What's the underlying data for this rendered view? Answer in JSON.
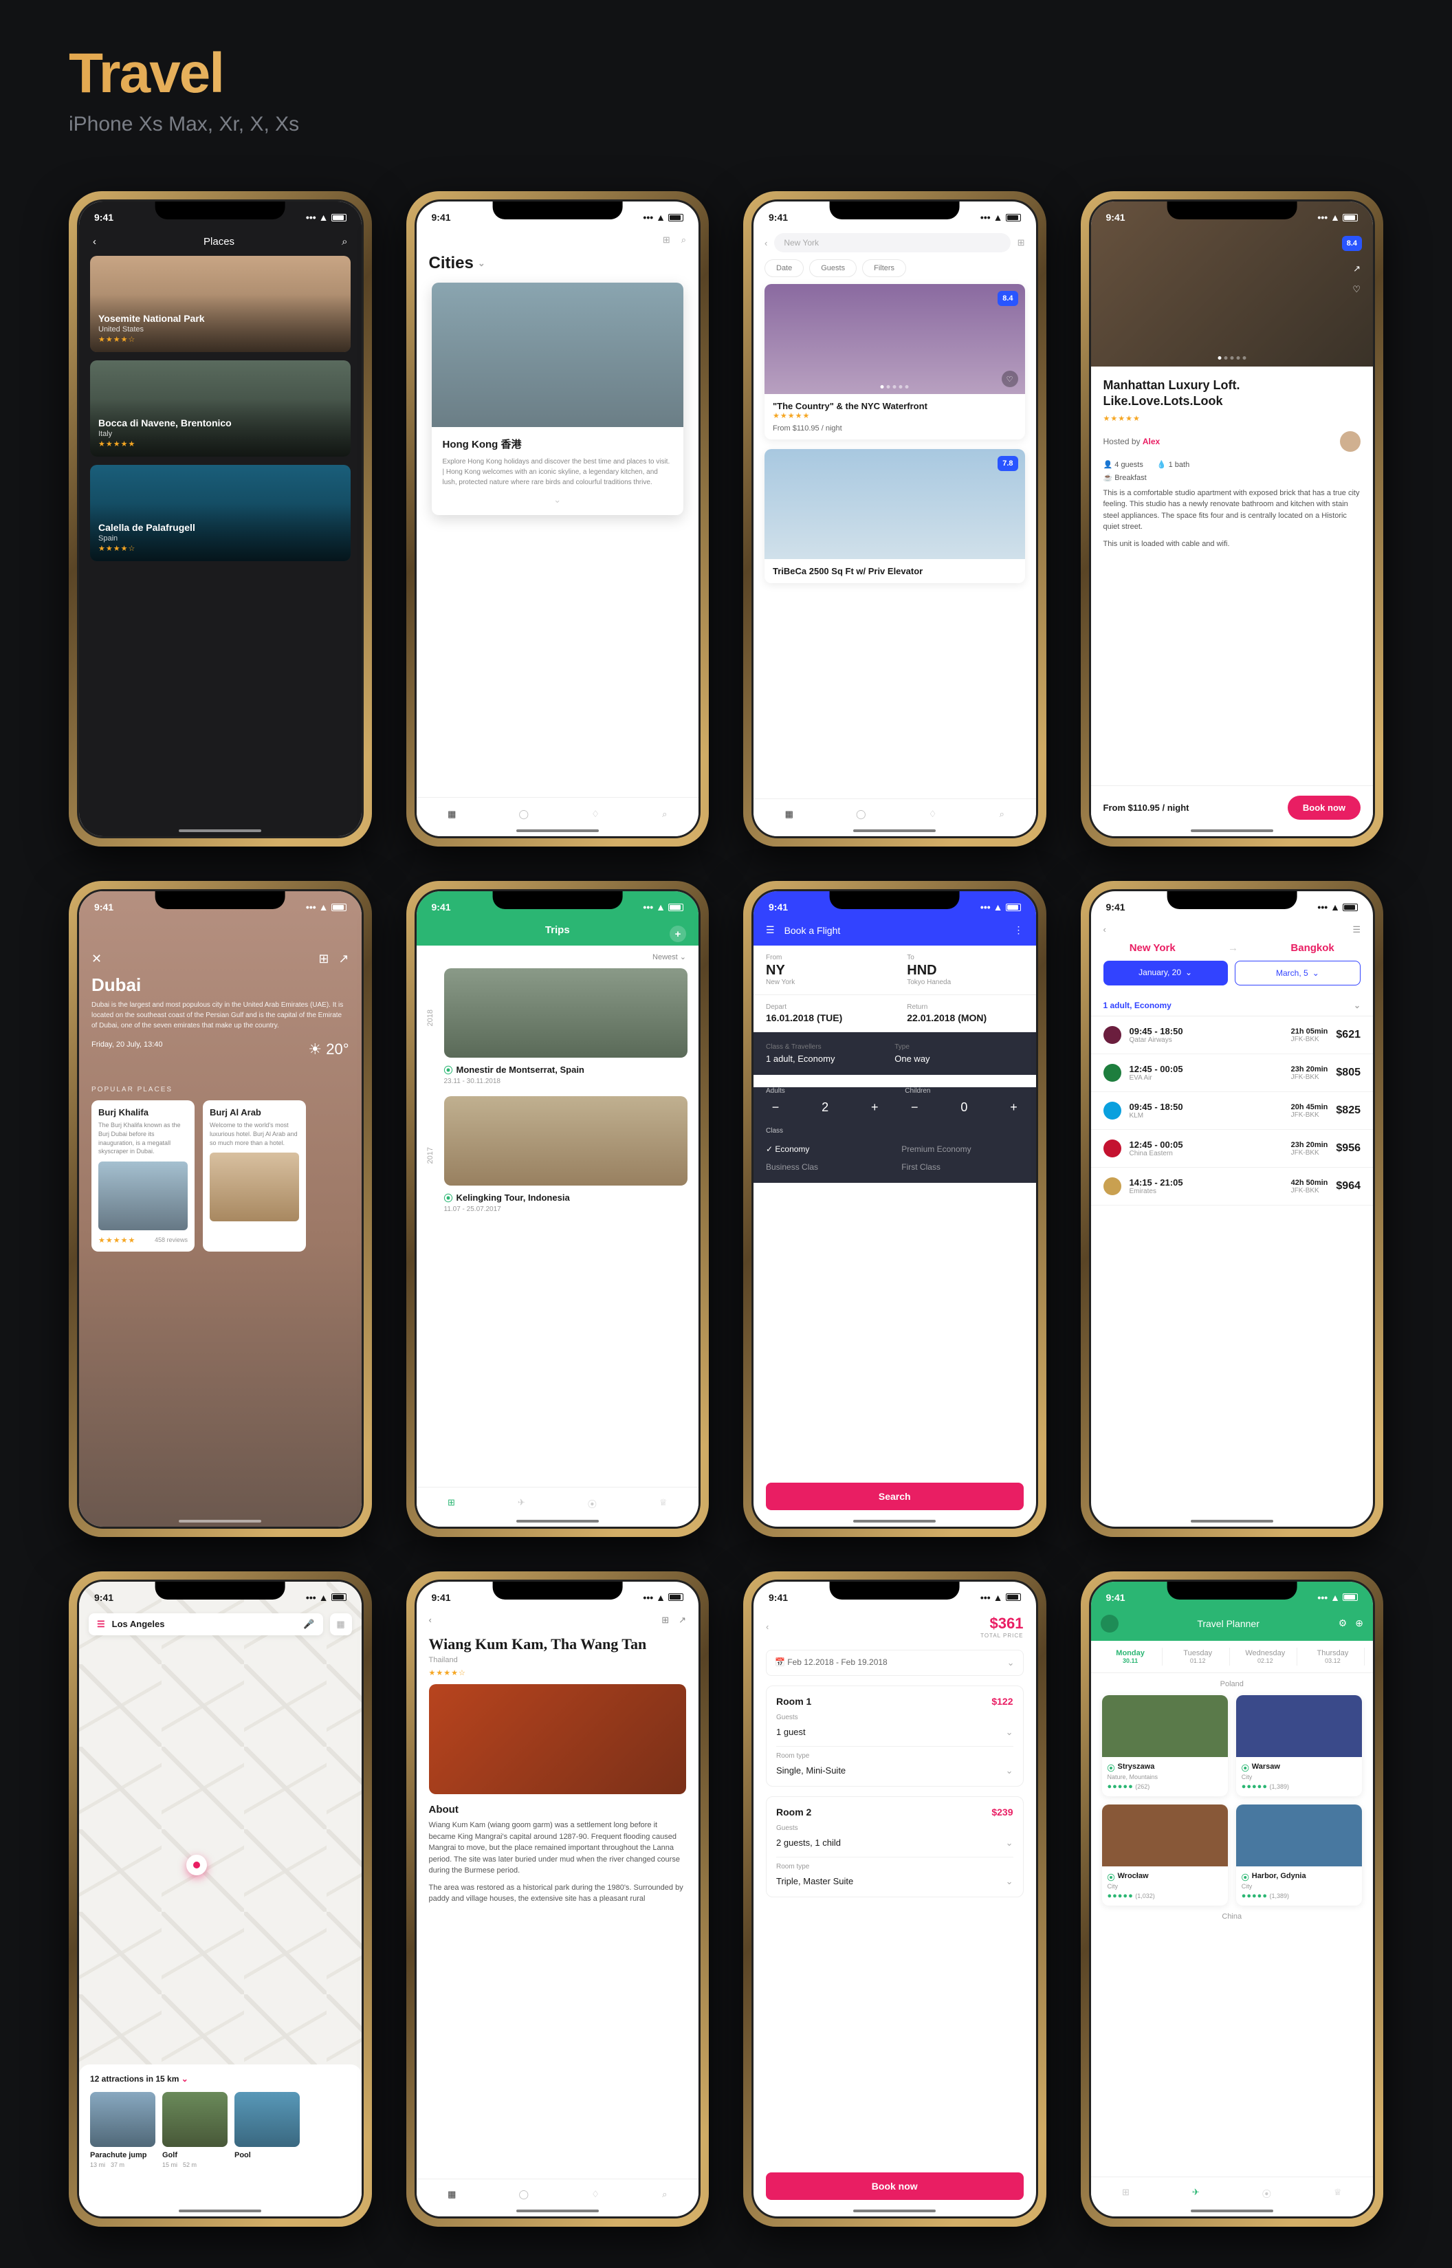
{
  "page": {
    "title": "Travel",
    "subtitle": "iPhone Xs Max, Xr, X, Xs",
    "time": "9:41"
  },
  "p1": {
    "title": "Places",
    "items": [
      {
        "name": "Yosemite National Park",
        "country": "United States"
      },
      {
        "name": "Bocca di Navene, Brentonico",
        "country": "Italy"
      },
      {
        "name": "Calella de Palafrugell",
        "country": "Spain"
      }
    ]
  },
  "p2": {
    "title": "Cities",
    "city": {
      "name": "Hong Kong 香港",
      "desc": "Explore Hong Kong holidays and discover the best time and places to visit. | Hong Kong welcomes with an iconic skyline, a legendary kitchen, and lush, protected nature where rare birds and colourful traditions thrive."
    }
  },
  "p3": {
    "search": "New York",
    "filters": [
      "Date",
      "Guests",
      "Filters"
    ],
    "hotels": [
      {
        "name": "\"The Country\" & the NYC Waterfront",
        "price": "From $110.95 / night",
        "rating": "8.4"
      },
      {
        "name": "TriBeCa 2500 Sq Ft w/ Priv Elevator",
        "rating": "7.8"
      }
    ]
  },
  "p4": {
    "title": "Manhattan Luxury Loft. Like.Love.Lots.Look",
    "rating": "8.4",
    "host_label": "Hosted by",
    "host": "Alex",
    "guests": "4 guests",
    "bath": "1 bath",
    "breakfast": "Breakfast",
    "desc1": "This is a comfortable studio apartment with exposed brick that has a true city feeling. This studio has a newly renovate bathroom and kitchen with stain steel appliances. The space fits four and is centrally located on a Historic quiet street.",
    "desc2": "This unit is loaded with cable and wifi.",
    "price": "From $110.95 / night",
    "book": "Book now"
  },
  "p5": {
    "title": "Dubai",
    "desc": "Dubai is the largest and most populous city in the United Arab Emirates (UAE). It is located on the southeast coast of the Persian Gulf and is the capital of the Emirate of Dubai, one of the seven emirates that make up the country.",
    "date": "Friday, 20 July, 13:40",
    "temp": "20°",
    "label": "POPULAR PLACES",
    "places": [
      {
        "name": "Burj Khalifa",
        "desc": "The Burj Khalifa known as the Burj Dubai before its inauguration, is a megatall skyscraper in Dubai.",
        "reviews": "458 reviews"
      },
      {
        "name": "Burj Al Arab",
        "desc": "Welcome to the world's most luxurious hotel. Burj Al Arab and so much more than a hotel.",
        "reviews": ""
      }
    ]
  },
  "p6": {
    "title": "Trips",
    "sort": "Newest",
    "years": [
      "2018",
      "2017"
    ],
    "trips": [
      {
        "name": "Monestir de Montserrat, Spain",
        "date": "23.11 - 30.11.2018"
      },
      {
        "name": "Kelingking Tour, Indonesia",
        "date": "11.07 - 25.07.2017"
      }
    ]
  },
  "p7": {
    "title": "Book a Flight",
    "from_lbl": "From",
    "from": "NY",
    "from_city": "New York",
    "to_lbl": "To",
    "to": "HND",
    "to_city": "Tokyo Haneda",
    "depart_lbl": "Depart",
    "depart": "16.01.2018 (TUE)",
    "return_lbl": "Return",
    "return": "22.01.2018 (MON)",
    "class_lbl": "Class & Travellers",
    "class_val": "1 adult, Economy",
    "type_lbl": "Type",
    "type_val": "One way",
    "adults_lbl": "Adults",
    "adults": "2",
    "children_lbl": "Children",
    "children": "0",
    "class_head": "Class",
    "classes": [
      "Economy",
      "Premium Economy",
      "Business Clas",
      "First Class"
    ],
    "search": "Search"
  },
  "p8": {
    "from": "New York",
    "to": "Bangkok",
    "date_from": "January, 20",
    "date_to": "March, 5",
    "pax": "1 adult, Economy",
    "flights": [
      {
        "time": "09:45 - 18:50",
        "airline": "Qatar Airways",
        "dur": "21h 05min",
        "route": "JFK-BKK",
        "price": "$621",
        "color": "#6b1e3e"
      },
      {
        "time": "12:45 - 00:05",
        "airline": "EVA Air",
        "dur": "23h 20min",
        "route": "JFK-BKK",
        "price": "$805",
        "color": "#1e7e3e"
      },
      {
        "time": "09:45 - 18:50",
        "airline": "KLM",
        "dur": "20h 45min",
        "route": "JFK-BKK",
        "price": "$825",
        "color": "#0aa0de"
      },
      {
        "time": "12:45 - 00:05",
        "airline": "China Eastern",
        "dur": "23h 20min",
        "route": "JFK-BKK",
        "price": "$956",
        "color": "#c41230"
      },
      {
        "time": "14:15 - 21:05",
        "airline": "Emirates",
        "dur": "42h 50min",
        "route": "JFK-BKK",
        "price": "$964",
        "color": "#c9a050"
      }
    ]
  },
  "p9": {
    "location": "Los Angeles",
    "summary": "12 attractions in 15 km",
    "acts": [
      {
        "name": "Parachute jump",
        "dist": "13 mi",
        "time": "37 m"
      },
      {
        "name": "Golf",
        "dist": "15 mi",
        "time": "52 m"
      },
      {
        "name": "Pool",
        "dist": "",
        "time": ""
      }
    ]
  },
  "p10": {
    "title": "Wiang Kum Kam, Tha Wang Tan",
    "location": "Thailand",
    "about": "About",
    "p1": "Wiang Kum Kam (wiang goom garm) was a settlement long before it became King Mangrai's capital around 1287-90. Frequent flooding caused Mangrai to move, but the place remained important throughout the Lanna period. The site was later buried under mud when the river changed course during the Burmese period.",
    "p2": "The area was restored as a historical park during the 1980's. Surrounded by paddy and village houses, the extensive site has a pleasant rural"
  },
  "p11": {
    "total": "$361",
    "total_lbl": "TOTAL PRICE",
    "range": "Feb 12.2018 - Feb 19.2018",
    "rooms": [
      {
        "name": "Room 1",
        "price": "$122",
        "guests_lbl": "Guests",
        "guests": "1 guest",
        "type_lbl": "Room type",
        "type": "Single, Mini-Suite"
      },
      {
        "name": "Room 2",
        "price": "$239",
        "guests_lbl": "Guests",
        "guests": "2 guests, 1 child",
        "type_lbl": "Room type",
        "type": "Triple, Master Suite"
      }
    ],
    "book": "Book now"
  },
  "p12": {
    "title": "Travel Planner",
    "days": [
      {
        "name": "Monday",
        "date": "30.11",
        "active": true
      },
      {
        "name": "Tuesday",
        "date": "01.12"
      },
      {
        "name": "Wednesday",
        "date": "02.12"
      },
      {
        "name": "Thursday",
        "date": "03.12"
      }
    ],
    "countries": [
      "Poland",
      "China"
    ],
    "places": [
      {
        "name": "Stryszawa",
        "type": "Nature, Mountains",
        "reviews": "(262)"
      },
      {
        "name": "Warsaw",
        "type": "City",
        "reviews": "(1,389)"
      },
      {
        "name": "Wrocław",
        "type": "City",
        "reviews": "(1,032)"
      },
      {
        "name": "Harbor, Gdynia",
        "type": "City",
        "reviews": "(1,389)"
      }
    ]
  }
}
